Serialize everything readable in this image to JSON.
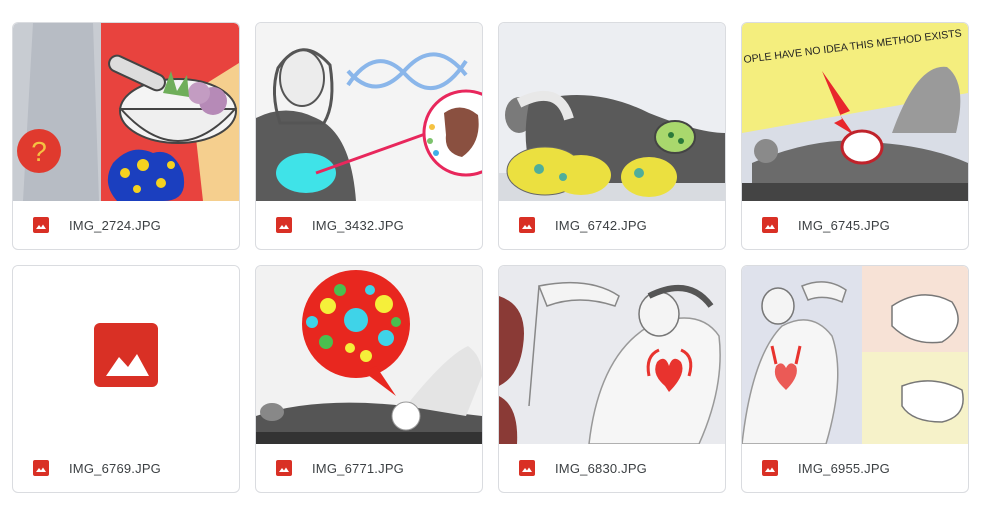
{
  "files": [
    {
      "name": "IMG_2724.JPG",
      "icon": "image-file-icon",
      "thumb": "herbal-mortar-illustration"
    },
    {
      "name": "IMG_3432.JPG",
      "icon": "image-file-icon",
      "thumb": "woman-digestion-dna-illustration"
    },
    {
      "name": "IMG_6742.JPG",
      "icon": "image-file-icon",
      "thumb": "lying-woman-bacteria-illustration"
    },
    {
      "name": "IMG_6745.JPG",
      "icon": "image-file-icon",
      "thumb": "method-exists-illustration",
      "banner": "OPLE HAVE NO IDEA THIS METHOD EXISTS"
    },
    {
      "name": "IMG_6769.JPG",
      "icon": "image-file-icon",
      "thumb": "no-preview"
    },
    {
      "name": "IMG_6771.JPG",
      "icon": "image-file-icon",
      "thumb": "gut-bacteria-bubble-illustration"
    },
    {
      "name": "IMG_6830.JPG",
      "icon": "image-file-icon",
      "thumb": "drinking-woman-heart-illustration"
    },
    {
      "name": "IMG_6955.JPG",
      "icon": "image-file-icon",
      "thumb": "drinking-man-heart-illustration"
    }
  ],
  "colors": {
    "file_icon": "#d93025",
    "border": "#dadce0",
    "text": "#3c4043"
  }
}
